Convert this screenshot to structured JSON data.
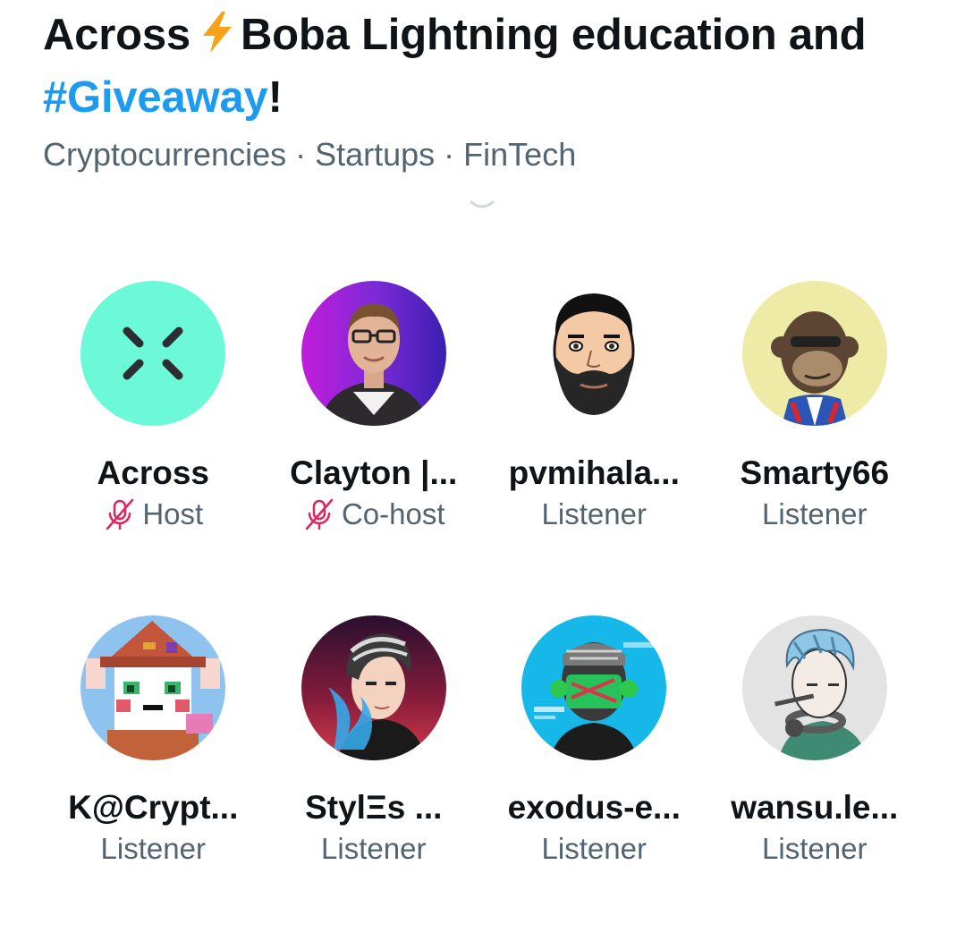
{
  "space": {
    "title_part1": "Across",
    "title_part2": "Boba Lightning education and",
    "title_hashtag": "#Giveaway",
    "title_end": "!",
    "topics": [
      "Cryptocurrencies",
      "Startups",
      "FinTech"
    ],
    "topic_separator": "·"
  },
  "participants": [
    {
      "name": "Across",
      "role": "Host",
      "muted": true,
      "avatar": "across-logo"
    },
    {
      "name": "Clayton |...",
      "role": "Co-host",
      "muted": true,
      "avatar": "clayton-photo"
    },
    {
      "name": "pvmihala...",
      "role": "Listener",
      "muted": false,
      "avatar": "bearded-cartoon"
    },
    {
      "name": "Smarty66",
      "role": "Listener",
      "muted": false,
      "avatar": "ape-nft"
    },
    {
      "name": "K@Crypt...",
      "role": "Listener",
      "muted": false,
      "avatar": "pixel-witch"
    },
    {
      "name": "StylΞs ...",
      "role": "Listener",
      "muted": false,
      "avatar": "anime-boy"
    },
    {
      "name": "exodus-e...",
      "role": "Listener",
      "muted": false,
      "avatar": "glitch-robot"
    },
    {
      "name": "wansu.le...",
      "role": "Listener",
      "muted": false,
      "avatar": "headset-boy"
    }
  ],
  "colors": {
    "text": "#0f1419",
    "secondary": "#536471",
    "hashtag": "#1d9bf0",
    "muted_mic": "#e0245e",
    "bolt": "#f7a21b"
  }
}
